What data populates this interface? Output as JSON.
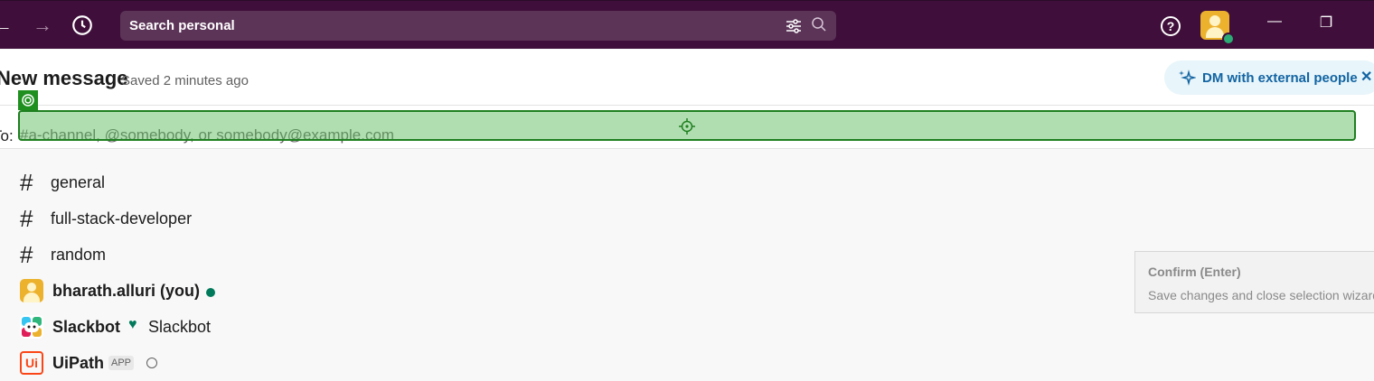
{
  "topbar": {
    "search_placeholder": "Search personal"
  },
  "header": {
    "title": "New message",
    "saved_status": "Saved 2 minutes ago",
    "dm_pill_label": "DM with external people"
  },
  "to_field": {
    "label": "To:",
    "placeholder": "#a-channel, @somebody, or somebody@example.com"
  },
  "suggestions": [
    {
      "type": "channel",
      "label": "general"
    },
    {
      "type": "channel",
      "label": "full-stack-developer"
    },
    {
      "type": "channel",
      "label": "random"
    },
    {
      "type": "user",
      "label": "bharath.alluri (you)",
      "status": "online"
    },
    {
      "type": "bot",
      "label": "Slackbot",
      "sub_label": "Slackbot"
    },
    {
      "type": "app",
      "label": "UiPath",
      "badge": "APP"
    }
  ],
  "tooltip": {
    "title": "Confirm (Enter)",
    "description": "Save changes and close selection wizard"
  },
  "colors": {
    "topbar": "#3f0e3a",
    "accent_blue": "#1264a3",
    "online": "#007a5a",
    "highlight_border": "#1f7f1f"
  }
}
